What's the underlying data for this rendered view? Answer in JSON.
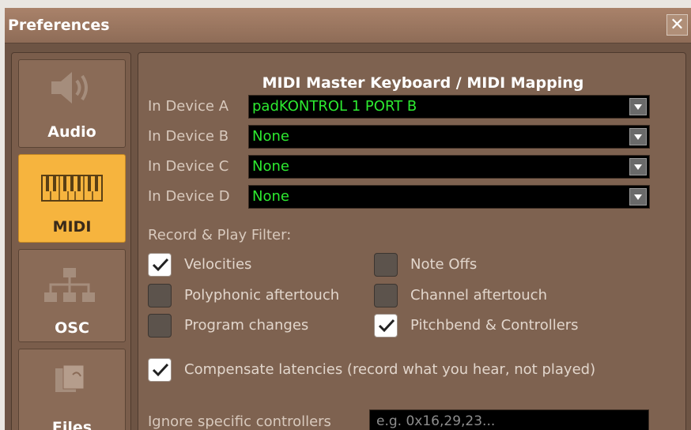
{
  "window": {
    "title": "Preferences",
    "close_icon": "close-icon"
  },
  "sidebar": {
    "items": [
      {
        "label": "Audio",
        "icon": "speaker-icon",
        "active": false
      },
      {
        "label": "MIDI",
        "icon": "keyboard-icon",
        "active": true
      },
      {
        "label": "OSC",
        "icon": "network-icon",
        "active": false
      },
      {
        "label": "Files",
        "icon": "files-icon",
        "active": false
      }
    ]
  },
  "panel": {
    "section_title": "MIDI Master Keyboard / MIDI Mapping",
    "devices": [
      {
        "label": "In Device A",
        "value": "padKONTROL 1 PORT B"
      },
      {
        "label": "In Device B",
        "value": "None"
      },
      {
        "label": "In Device C",
        "value": "None"
      },
      {
        "label": "In Device D",
        "value": "None"
      }
    ],
    "filter_heading": "Record & Play Filter:",
    "filters": [
      {
        "label": "Velocities",
        "checked": true
      },
      {
        "label": "Note Offs",
        "checked": false
      },
      {
        "label": "Polyphonic aftertouch",
        "checked": false
      },
      {
        "label": "Channel aftertouch",
        "checked": false
      },
      {
        "label": "Program changes",
        "checked": false
      },
      {
        "label": "Pitchbend & Controllers",
        "checked": true
      }
    ],
    "compensate": {
      "label": "Compensate latencies (record what you hear, not played)",
      "checked": true
    },
    "ignore": {
      "label": "Ignore specific controllers",
      "placeholder": "e.g. 0x16,29,23..."
    }
  },
  "colors": {
    "accent": "#f6b43e",
    "device_text": "#2dea30",
    "panel_bg": "#7e6250"
  }
}
